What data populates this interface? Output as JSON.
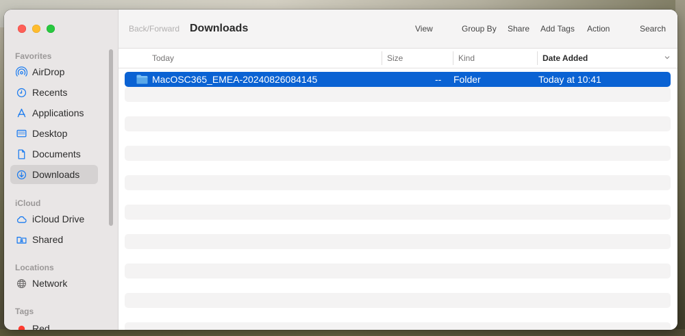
{
  "window": {
    "toolbar": {
      "back_forward": "Back/Forward",
      "title": "Downloads",
      "view": "View",
      "group_by": "Group By",
      "share": "Share",
      "add_tags": "Add Tags",
      "action": "Action",
      "search": "Search"
    },
    "sidebar": {
      "favorites_title": "Favorites",
      "favorites": [
        {
          "label": "AirDrop",
          "icon": "airdrop-icon"
        },
        {
          "label": "Recents",
          "icon": "clock-icon"
        },
        {
          "label": "Applications",
          "icon": "applications-icon"
        },
        {
          "label": "Desktop",
          "icon": "desktop-icon"
        },
        {
          "label": "Documents",
          "icon": "document-icon"
        },
        {
          "label": "Downloads",
          "icon": "download-icon",
          "active": true
        }
      ],
      "icloud_title": "iCloud",
      "icloud": [
        {
          "label": "iCloud Drive",
          "icon": "cloud-icon"
        },
        {
          "label": "Shared",
          "icon": "shared-folder-icon"
        }
      ],
      "locations_title": "Locations",
      "locations": [
        {
          "label": "Network",
          "icon": "globe-icon"
        }
      ],
      "tags_title": "Tags",
      "tags": [
        {
          "label": "Red",
          "color": "#ff3b30"
        }
      ]
    },
    "columns": {
      "name": "Today",
      "size": "Size",
      "kind": "Kind",
      "date_added": "Date Added"
    },
    "files": [
      {
        "name": "MacOSC365_EMEA-20240826084145",
        "size": "--",
        "kind": "Folder",
        "date_added": "Today at 10:41",
        "selected": true
      }
    ],
    "colors": {
      "selection": "#0a62d3",
      "folder": "#5aa8e8",
      "close": "#fe5f57",
      "minimize": "#febc2e",
      "zoom": "#28c840"
    }
  }
}
